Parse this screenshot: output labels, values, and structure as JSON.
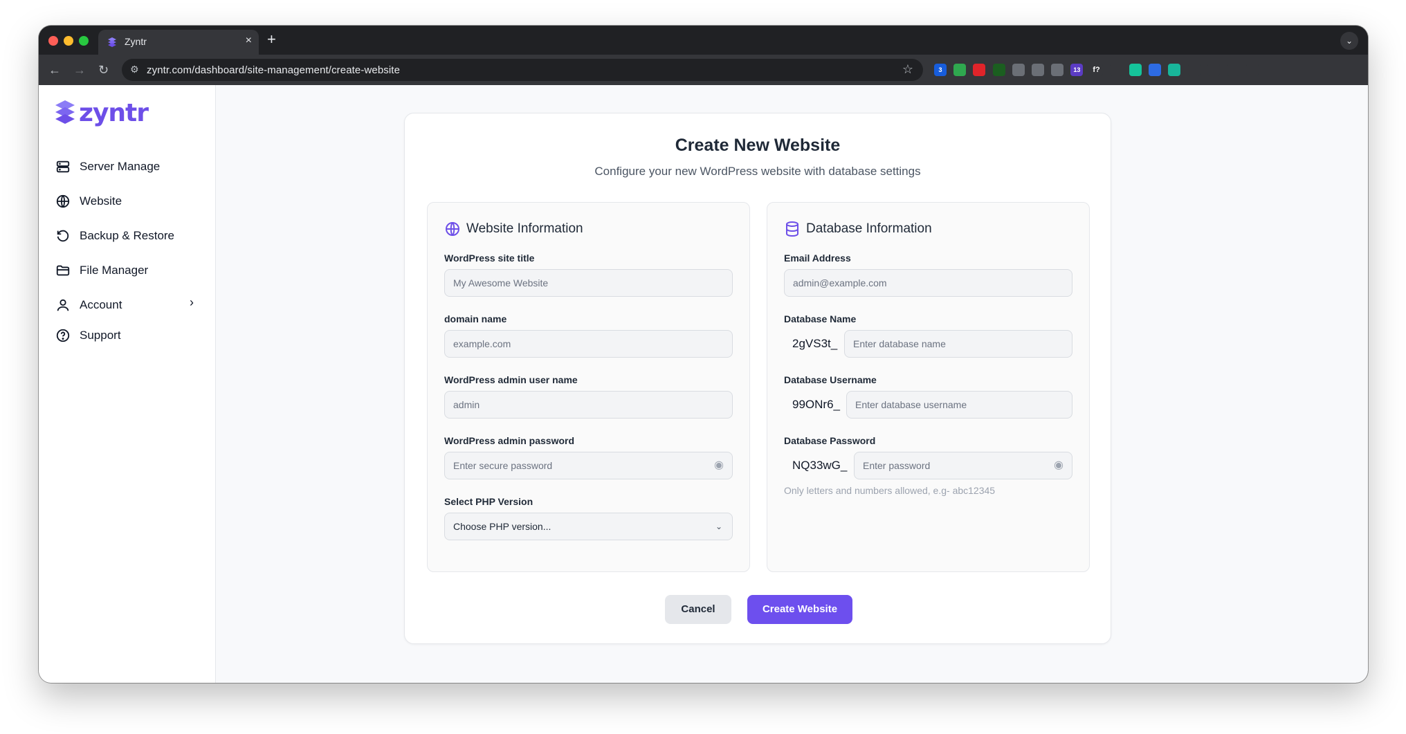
{
  "browser": {
    "tab_title": "Zyntr",
    "tab_close": "×",
    "new_tab": "+",
    "tab_menu": "⌄",
    "url": "zyntr.com/dashboard/site-management/create-website",
    "extensions": [
      {
        "name": "bitwarden-icon",
        "color": "#175ddc",
        "badge": "3"
      },
      {
        "name": "shield-icon",
        "color": "#2fa84f"
      },
      {
        "name": "youtube-icon",
        "color": "#e0242a"
      },
      {
        "name": "stripe-icon",
        "color": "#1b5e20"
      },
      {
        "name": "gear-icon",
        "color": "#6b6f76"
      },
      {
        "name": "diamond-icon",
        "color": "#6b6f76"
      },
      {
        "name": "compass-icon",
        "color": "#6b6f76"
      },
      {
        "name": "badge-icon",
        "color": "#5b3cc4",
        "badge": "13"
      },
      {
        "name": "formula-icon",
        "color": "#35363a",
        "glyph": "f?"
      },
      {
        "name": "slash-icon",
        "color": "#35363a"
      },
      {
        "name": "grammarly-icon",
        "color": "#15c39a"
      },
      {
        "name": "app-icon",
        "color": "#2d6be4"
      },
      {
        "name": "shield-check-icon",
        "color": "#18b59a"
      },
      {
        "name": "puzzle-icon",
        "color": "#35363a"
      },
      {
        "name": "playlist-icon",
        "color": "#35363a"
      },
      {
        "name": "profile-icon",
        "color": "#35363a"
      },
      {
        "name": "more-icon",
        "color": "#35363a"
      }
    ]
  },
  "brand": {
    "name": "zyntr",
    "color": "#6d4fe8"
  },
  "sidebar": {
    "items": [
      {
        "label": "Server Manage",
        "icon": "server-icon"
      },
      {
        "label": "Website",
        "icon": "globe-icon"
      },
      {
        "label": "Backup & Restore",
        "icon": "restore-icon"
      },
      {
        "label": "File Manager",
        "icon": "folder-icon"
      },
      {
        "label": "Account",
        "icon": "user-icon"
      },
      {
        "label": "Support",
        "icon": "help-icon"
      }
    ]
  },
  "form": {
    "title": "Create New Website",
    "subtitle": "Configure your new WordPress website with database settings",
    "website": {
      "heading": "Website Information",
      "site_title": {
        "label": "WordPress site title",
        "placeholder": "My Awesome Website"
      },
      "domain": {
        "label": "domain name",
        "placeholder": "example.com"
      },
      "admin_user": {
        "label": "WordPress admin user name",
        "placeholder": "admin"
      },
      "admin_password": {
        "label": "WordPress admin password",
        "placeholder": "Enter secure password"
      },
      "php_version": {
        "label": "Select PHP Version",
        "value": "Choose PHP version..."
      }
    },
    "database": {
      "heading": "Database Information",
      "email": {
        "label": "Email Address",
        "placeholder": "admin@example.com"
      },
      "db_name": {
        "label": "Database Name",
        "prefix": "2gVS3t_",
        "placeholder": "Enter database name"
      },
      "db_user": {
        "label": "Database Username",
        "prefix": "99ONr6_",
        "placeholder": "Enter database username"
      },
      "db_password": {
        "label": "Database Password",
        "prefix": "NQ33wG_",
        "placeholder": "Enter password",
        "hint": "Only letters and numbers allowed, e.g- abc12345"
      }
    },
    "cancel_label": "Cancel",
    "submit_label": "Create Website",
    "accent": "#6d4fee"
  }
}
